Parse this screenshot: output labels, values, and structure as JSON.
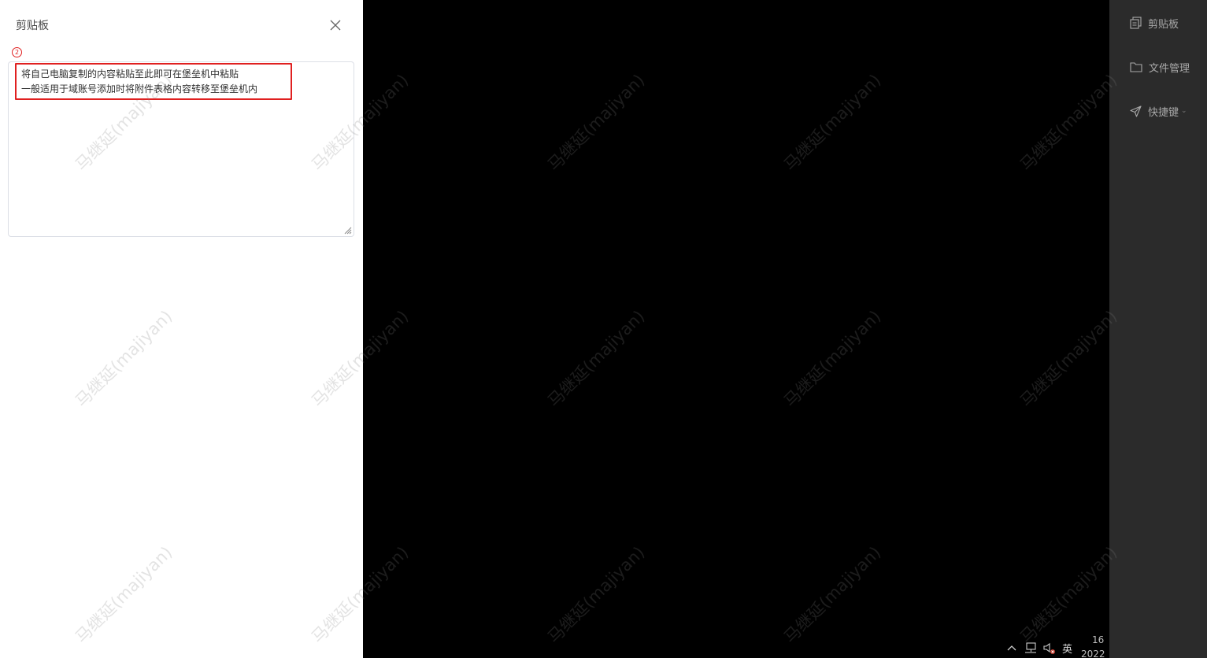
{
  "drawer": {
    "title": "剪贴板",
    "step_marker": "2",
    "textarea_lines": "将自己电脑复制的内容粘贴至此即可在堡垒机中粘贴\n一般适用于域账号添加时将附件表格内容转移至堡垒机内"
  },
  "side_menu": {
    "items": [
      {
        "label": "剪贴板",
        "icon": "clipboard-icon"
      },
      {
        "label": "文件管理",
        "icon": "folder-icon"
      },
      {
        "label": "快捷键",
        "icon": "send-icon",
        "has_dropdown": true
      }
    ]
  },
  "taskbar": {
    "input_method": "英",
    "clock_time": "16",
    "clock_date": "2022"
  },
  "watermark": {
    "text": "马继延(majiyan)"
  },
  "colors": {
    "highlight": "#e02020",
    "side_menu_bg": "#2b2b2b",
    "desktop_bg": "#000000"
  }
}
